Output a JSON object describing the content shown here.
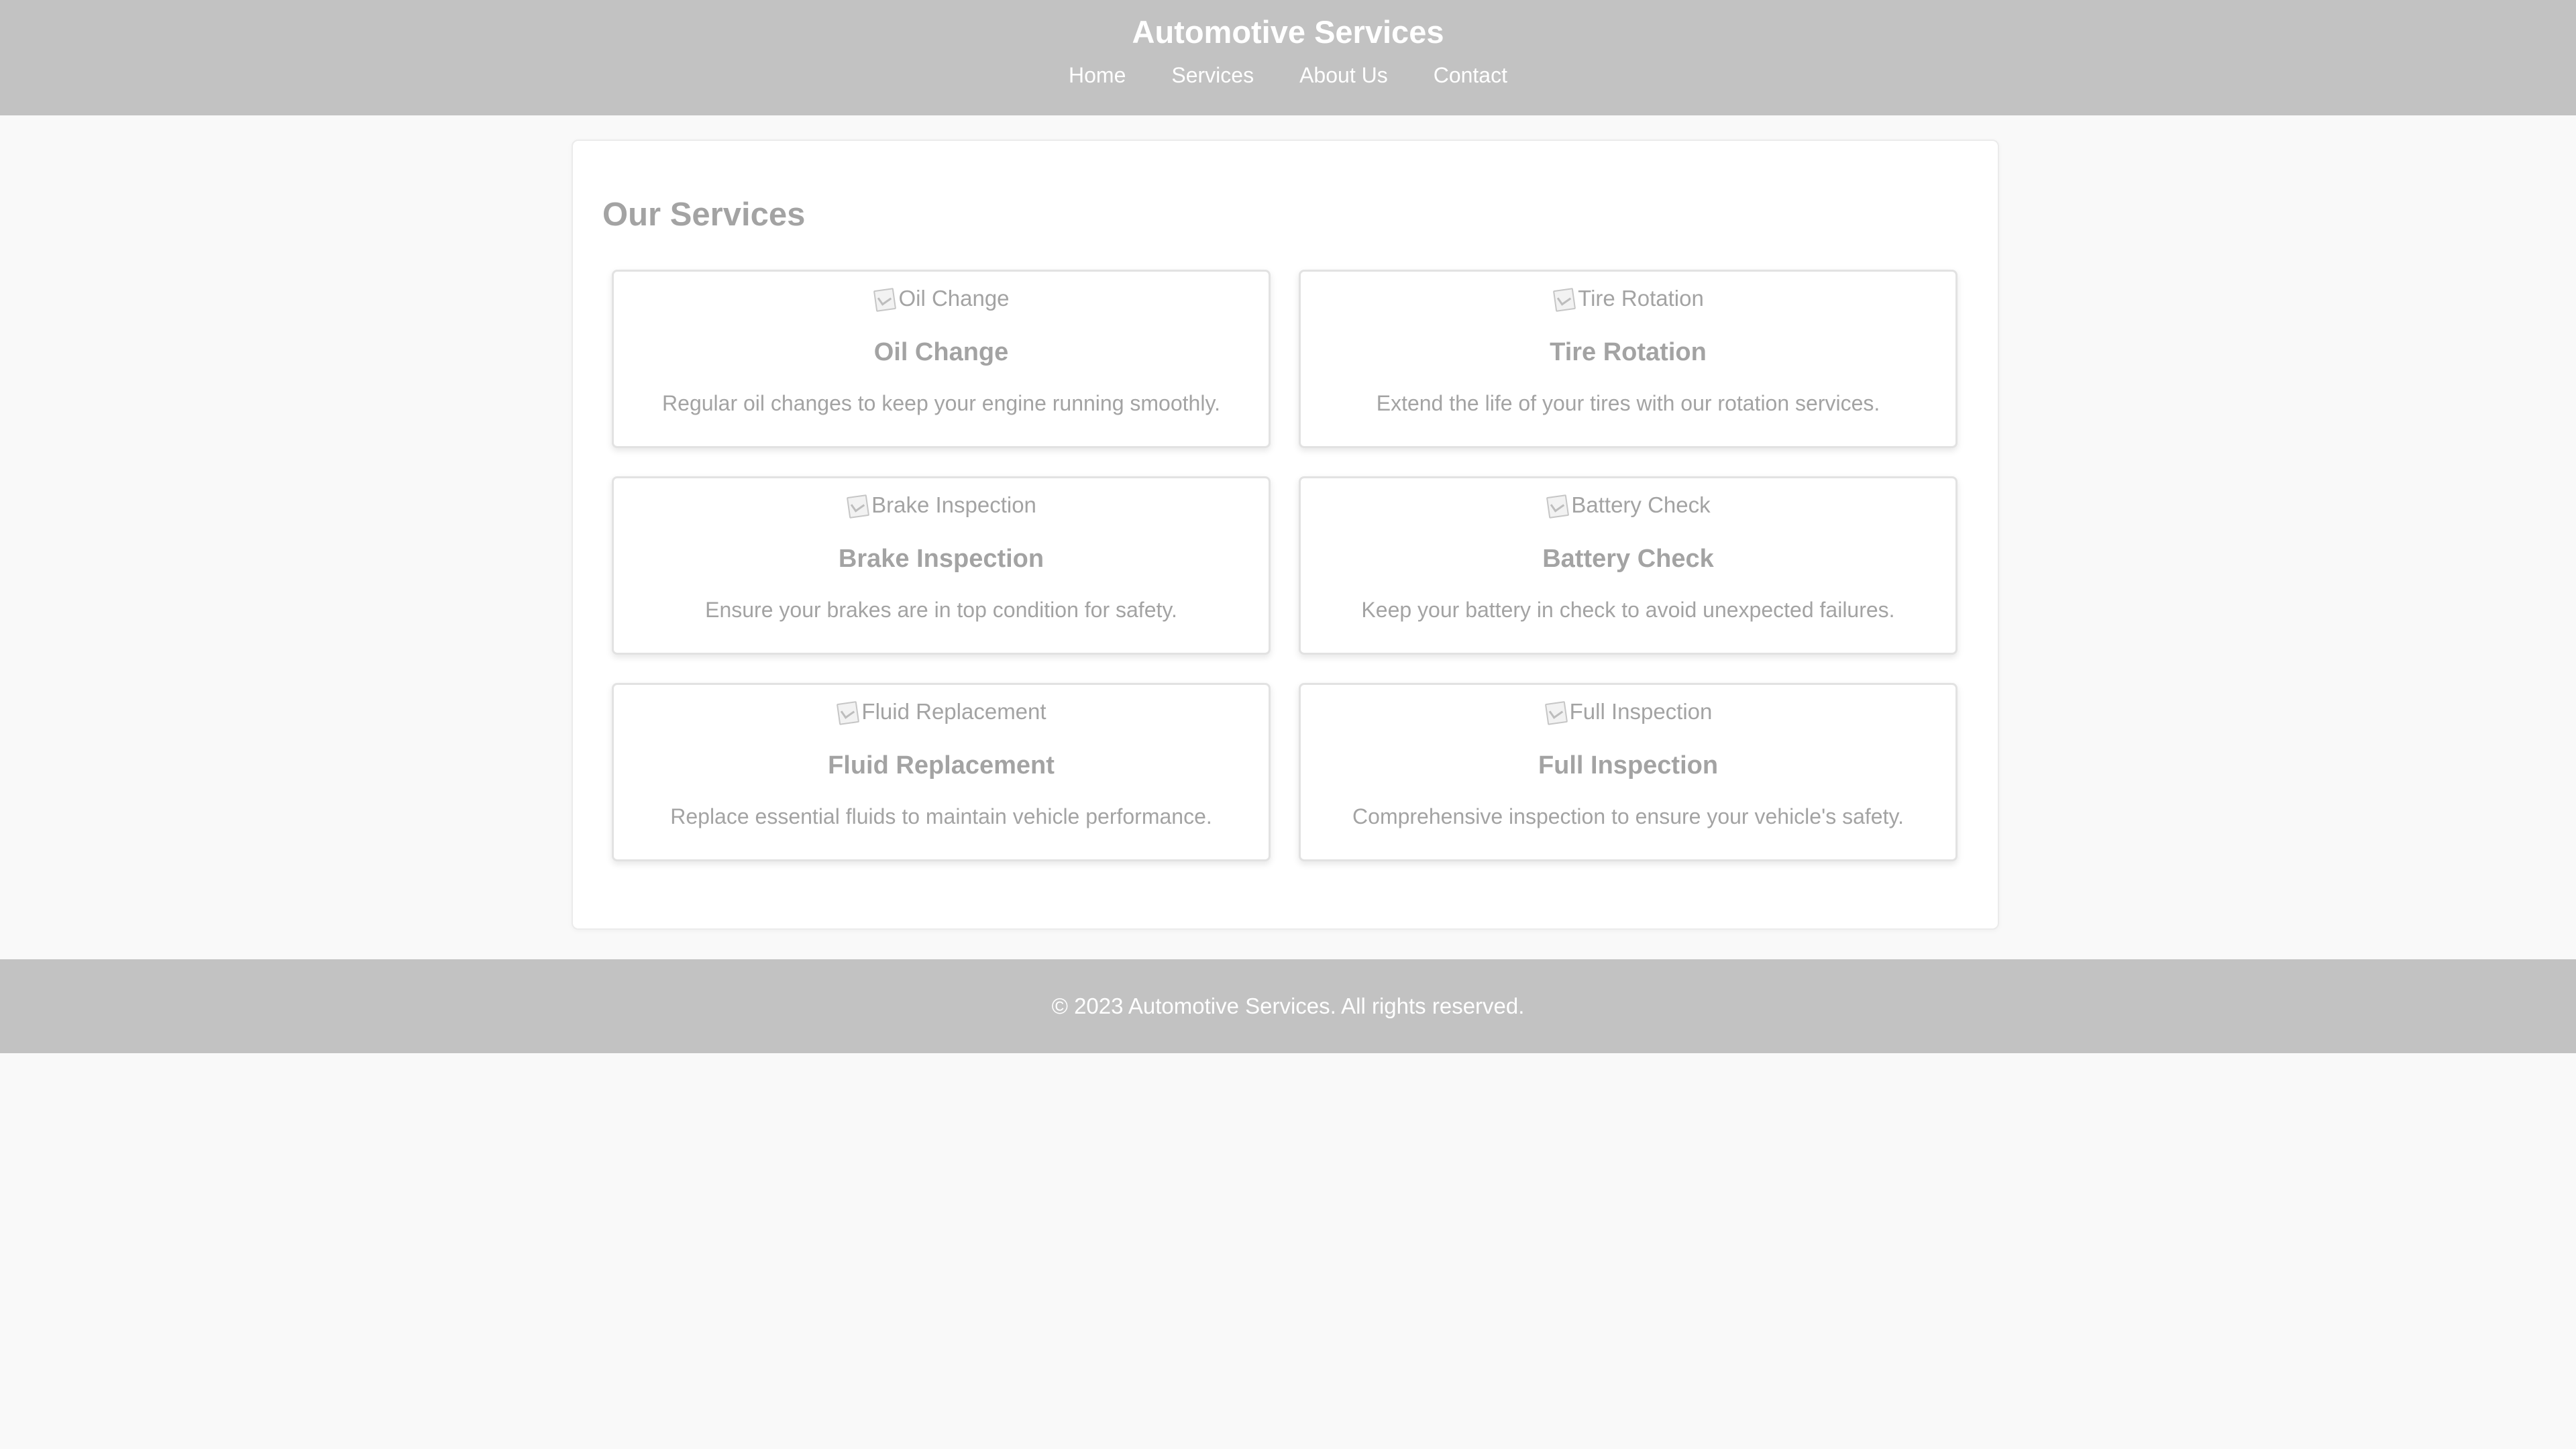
{
  "header": {
    "title": "Automotive Services",
    "nav": [
      "Home",
      "Services",
      "About Us",
      "Contact"
    ]
  },
  "main": {
    "section_title": "Our Services",
    "services": [
      {
        "image_alt": "Oil Change",
        "title": "Oil Change",
        "description": "Regular oil changes to keep your engine running smoothly."
      },
      {
        "image_alt": "Tire Rotation",
        "title": "Tire Rotation",
        "description": "Extend the life of your tires with our rotation services."
      },
      {
        "image_alt": "Brake Inspection",
        "title": "Brake Inspection",
        "description": "Ensure your brakes are in top condition for safety."
      },
      {
        "image_alt": "Battery Check",
        "title": "Battery Check",
        "description": "Keep your battery in check to avoid unexpected failures."
      },
      {
        "image_alt": "Fluid Replacement",
        "title": "Fluid Replacement",
        "description": "Replace essential fluids to maintain vehicle performance."
      },
      {
        "image_alt": "Full Inspection",
        "title": "Full Inspection",
        "description": "Comprehensive inspection to ensure your vehicle's safety."
      }
    ]
  },
  "footer": {
    "text": "© 2023 Automotive Services. All rights reserved."
  },
  "colors": {
    "header_bg": "#c2c2c2",
    "page_bg": "#f9f9f9",
    "muted_text": "#a3a3a3",
    "header_text": "#ffffff"
  }
}
